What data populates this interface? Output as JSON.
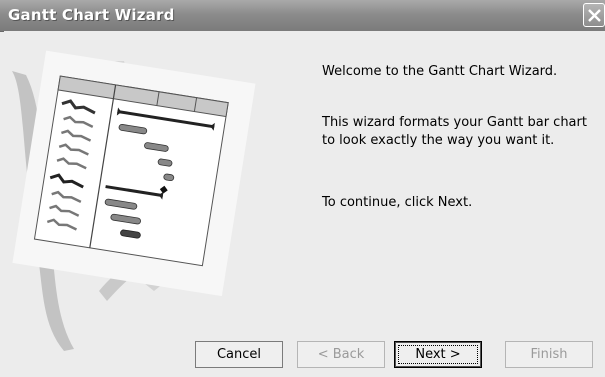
{
  "window": {
    "title": "Gantt Chart Wizard"
  },
  "content": {
    "welcome": "Welcome to the Gantt Chart Wizard.",
    "description": "This wizard formats your Gantt bar chart to look exactly the way you want it.",
    "instruction": "To continue, click Next."
  },
  "buttons": {
    "cancel": "Cancel",
    "back": "< Back",
    "next": "Next >",
    "finish": "Finish"
  },
  "icons": {
    "close": "close-icon",
    "illustration": "gantt-chart-illustration"
  }
}
